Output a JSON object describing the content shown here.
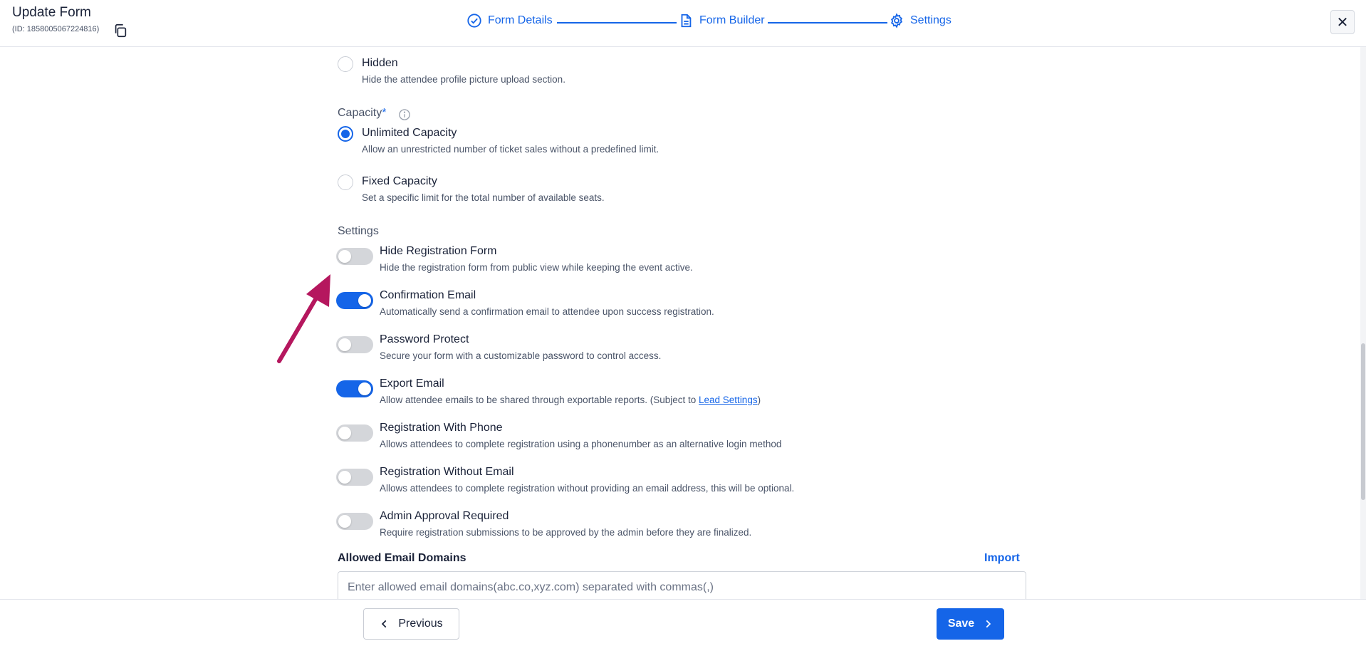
{
  "header": {
    "title": "Update Form",
    "form_id": "(ID: 1858005067224816)",
    "steps": [
      {
        "label": "Form Details"
      },
      {
        "label": "Form Builder"
      },
      {
        "label": "Settings"
      }
    ],
    "close_label": "✕"
  },
  "profile_picture": {
    "hidden": {
      "title": "Hidden",
      "desc": "Hide the attendee profile picture upload section.",
      "checked": false
    }
  },
  "capacity": {
    "label": "Capacity",
    "required_mark": "*",
    "options": [
      {
        "title": "Unlimited Capacity",
        "desc": "Allow an unrestricted number of ticket sales without a predefined limit.",
        "checked": true
      },
      {
        "title": "Fixed Capacity",
        "desc": "Set a specific limit for the total number of available seats.",
        "checked": false
      }
    ]
  },
  "settings": {
    "label": "Settings",
    "items": [
      {
        "title": "Hide Registration Form",
        "desc": "Hide the registration form from public view while keeping the event active.",
        "on": false
      },
      {
        "title": "Confirmation Email",
        "desc": "Automatically send a confirmation email to attendee upon success registration.",
        "on": true
      },
      {
        "title": "Password Protect",
        "desc": "Secure your form with a customizable password to control access.",
        "on": false
      },
      {
        "title": "Export Email",
        "desc": "Allow attendee emails to be shared through exportable reports. (Subject to ",
        "desc_link": "Lead Settings",
        "desc_suffix": ")",
        "on": true
      },
      {
        "title": "Registration With Phone",
        "desc": "Allows attendees to complete registration using a phonenumber as an alternative login method",
        "on": false
      },
      {
        "title": "Registration Without Email",
        "desc": "Allows attendees to complete registration without providing an email address, this will be optional.",
        "on": false
      },
      {
        "title": "Admin Approval Required",
        "desc": "Require registration submissions to be approved by the admin before they are finalized.",
        "on": false
      }
    ]
  },
  "allowed_domains": {
    "label": "Allowed Email Domains",
    "import_label": "Import",
    "placeholder": "Enter allowed email domains(abc.co,xyz.com) separated with commas(,)",
    "value": ""
  },
  "footer": {
    "previous_label": "Previous",
    "save_label": "Save"
  },
  "colors": {
    "accent": "#1565e8",
    "annotation_arrow": "#b5175e"
  }
}
